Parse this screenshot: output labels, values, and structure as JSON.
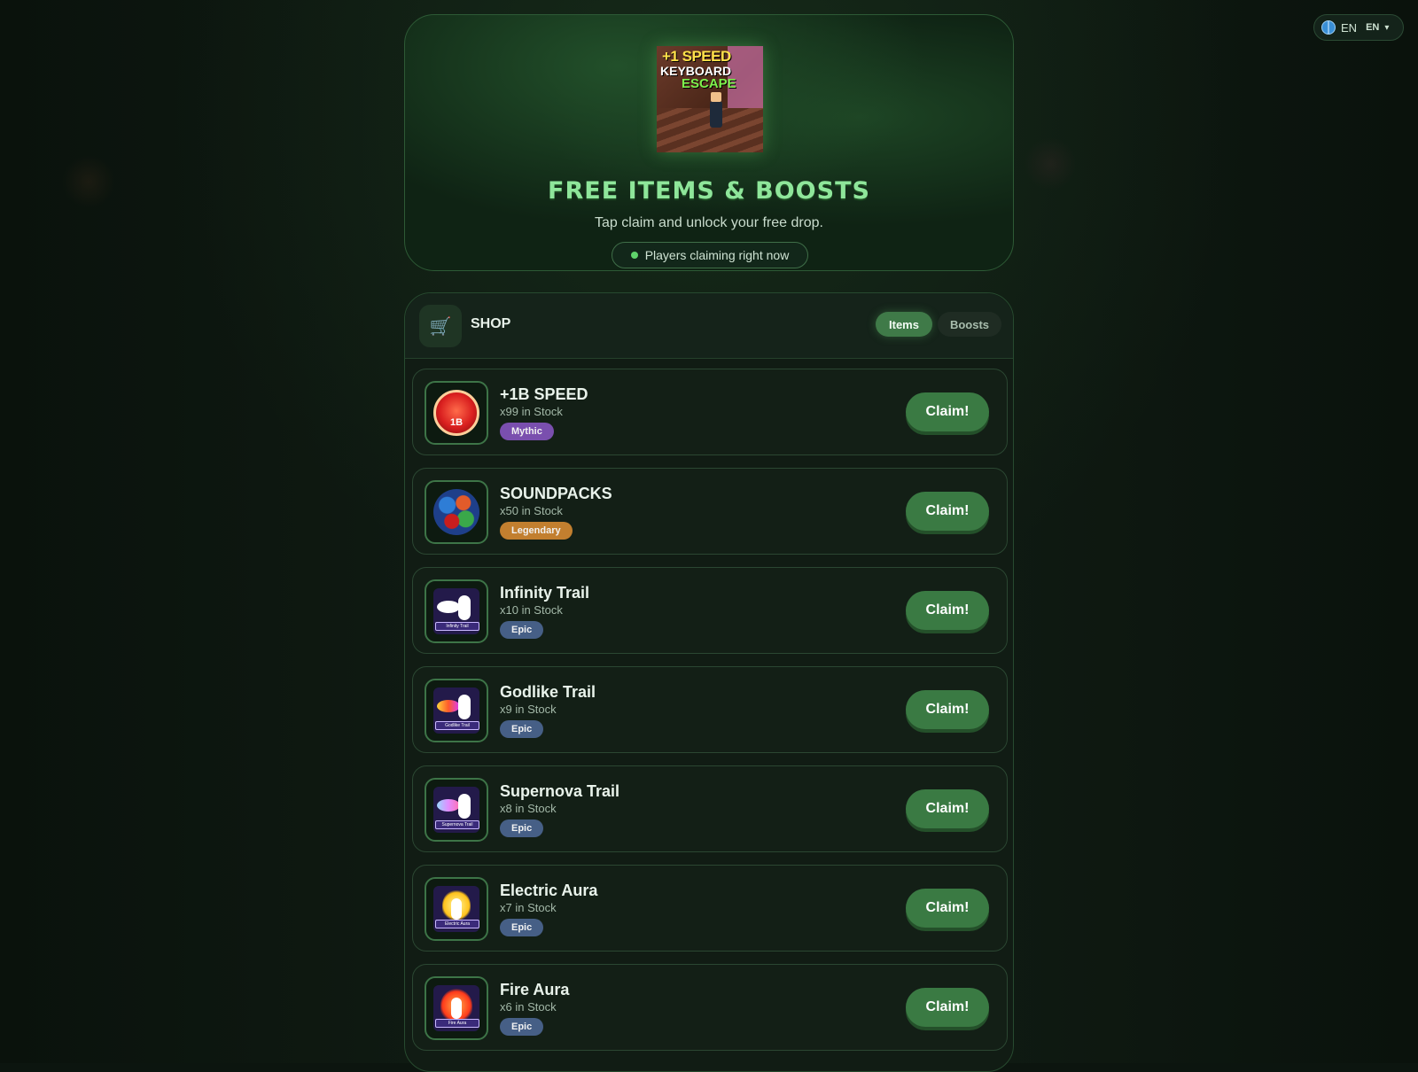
{
  "language": {
    "current": "EN",
    "selector": "EN"
  },
  "hero": {
    "game_thumbnail": {
      "line1": "+1 SPEED",
      "line2": "KEYBOARD",
      "line3": "ESCAPE"
    },
    "title": "FREE ITEMS & BOOSTS",
    "subtitle": "Tap claim and unlock your free drop.",
    "live_status": "Players claiming right now"
  },
  "shop": {
    "title": "SHOP",
    "tabs": [
      {
        "label": "Items",
        "active": true
      },
      {
        "label": "Boosts",
        "active": false
      }
    ],
    "items": [
      {
        "name": "+1B SPEED",
        "stock": "x99 in Stock",
        "rarity": "Mythic",
        "icon_text": "1B",
        "claim_label": "Claim!"
      },
      {
        "name": "SOUNDPACKS",
        "stock": "x50 in Stock",
        "rarity": "Legendary",
        "claim_label": "Claim!"
      },
      {
        "name": "Infinity Trail",
        "stock": "x10 in Stock",
        "rarity": "Epic",
        "icon_text": "Infinity Trail",
        "claim_label": "Claim!"
      },
      {
        "name": "Godlike Trail",
        "stock": "x9 in Stock",
        "rarity": "Epic",
        "icon_text": "Godlike Trail",
        "claim_label": "Claim!"
      },
      {
        "name": "Supernova Trail",
        "stock": "x8 in Stock",
        "rarity": "Epic",
        "icon_text": "Supernova Trail",
        "claim_label": "Claim!"
      },
      {
        "name": "Electric Aura",
        "stock": "x7 in Stock",
        "rarity": "Epic",
        "icon_text": "Electric Aura",
        "claim_label": "Claim!"
      },
      {
        "name": "Fire Aura",
        "stock": "x6 in Stock",
        "rarity": "Epic",
        "icon_text": "Fire Aura",
        "claim_label": "Claim!"
      }
    ]
  },
  "colors": {
    "accent": "#3a7a43",
    "title_green": "#8ee69a",
    "mythic": "#7a4fae",
    "legendary": "#c27f2f",
    "epic": "#465f86"
  }
}
